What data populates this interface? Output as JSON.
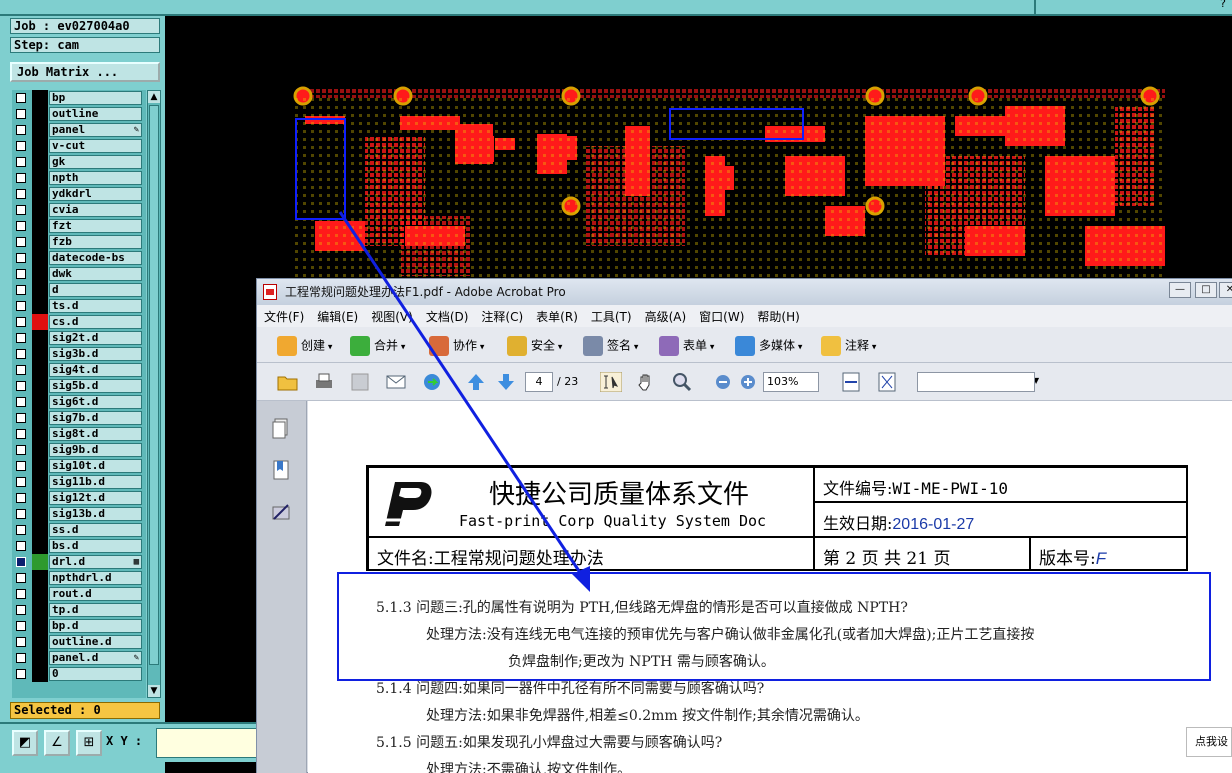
{
  "topbar": {
    "right_char": "?"
  },
  "cam": {
    "job_label": "Job : ev027004a0",
    "step_label": "Step: cam",
    "job_matrix_button": "Job Matrix ...",
    "selected_label": "Selected : 0",
    "xy_label": "X Y :",
    "layers": [
      {
        "name": "bp",
        "color": "#000000"
      },
      {
        "name": "outline",
        "color": "#000000"
      },
      {
        "name": "panel",
        "color": "#000000",
        "mark": "✎"
      },
      {
        "name": "v-cut",
        "color": "#000000"
      },
      {
        "name": "gk",
        "color": "#000000"
      },
      {
        "name": "npth",
        "color": "#000000"
      },
      {
        "name": "ydkdrl",
        "color": "#000000"
      },
      {
        "name": "cvia",
        "color": "#000000"
      },
      {
        "name": "fzt",
        "color": "#000000"
      },
      {
        "name": "fzb",
        "color": "#000000"
      },
      {
        "name": "datecode-bs",
        "color": "#000000"
      },
      {
        "name": "dwk",
        "color": "#000000"
      },
      {
        "name": "d",
        "color": "#000000"
      },
      {
        "name": "ts.d",
        "color": "#000000"
      },
      {
        "name": "cs.d",
        "color": "#e01010"
      },
      {
        "name": "sig2t.d",
        "color": "#000000"
      },
      {
        "name": "sig3b.d",
        "color": "#000000"
      },
      {
        "name": "sig4t.d",
        "color": "#000000"
      },
      {
        "name": "sig5b.d",
        "color": "#000000"
      },
      {
        "name": "sig6t.d",
        "color": "#000000"
      },
      {
        "name": "sig7b.d",
        "color": "#000000"
      },
      {
        "name": "sig8t.d",
        "color": "#000000"
      },
      {
        "name": "sig9b.d",
        "color": "#000000"
      },
      {
        "name": "sig10t.d",
        "color": "#000000"
      },
      {
        "name": "sig11b.d",
        "color": "#000000"
      },
      {
        "name": "sig12t.d",
        "color": "#000000"
      },
      {
        "name": "sig13b.d",
        "color": "#000000"
      },
      {
        "name": "ss.d",
        "color": "#000000"
      },
      {
        "name": "bs.d",
        "color": "#000000"
      },
      {
        "name": "drl.d",
        "color": "#2e9a2e",
        "mark": "▦",
        "active": true
      },
      {
        "name": "npthdrl.d",
        "color": "#000000"
      },
      {
        "name": "rout.d",
        "color": "#000000"
      },
      {
        "name": "tp.d",
        "color": "#000000"
      },
      {
        "name": "bp.d",
        "color": "#000000"
      },
      {
        "name": "outline.d",
        "color": "#000000"
      },
      {
        "name": "panel.d",
        "color": "#000000",
        "mark": "✎"
      },
      {
        "name": "0",
        "color": "#000000"
      }
    ]
  },
  "acrobat": {
    "title": "工程常规问题处理办法F1.pdf - Adobe Acrobat Pro",
    "menu": [
      "文件(F)",
      "编辑(E)",
      "视图(V)",
      "文档(D)",
      "注释(C)",
      "表单(R)",
      "工具(T)",
      "高级(A)",
      "窗口(W)",
      "帮助(H)"
    ],
    "toolbar": [
      {
        "label": "创建",
        "icon": "create-icon"
      },
      {
        "label": "合并",
        "icon": "combine-icon"
      },
      {
        "label": "协作",
        "icon": "collaborate-icon"
      },
      {
        "label": "安全",
        "icon": "lock-icon"
      },
      {
        "label": "签名",
        "icon": "pen-icon"
      },
      {
        "label": "表单",
        "icon": "form-icon"
      },
      {
        "label": "多媒体",
        "icon": "multimedia-icon"
      },
      {
        "label": "注释",
        "icon": "comment-icon"
      }
    ],
    "page_current": "4",
    "page_total": "/ 23",
    "zoom": "103%"
  },
  "doc": {
    "company_cn": "快捷公司质量体系文件",
    "company_en": "Fast-print Corp Quality System Doc",
    "doc_no_label": "文件编号:",
    "doc_no": "WI-ME-PWI-10",
    "date_label": "生效日期:",
    "date": "2016-01-27",
    "file_name": "文件名:工程常规问题处理办法",
    "page_info": "第 2 页 共 21 页",
    "version_label": "版本号:",
    "version": "F",
    "lines": [
      "5.1.3  问题三:孔的属性有说明为 PTH,但线路无焊盘的情形是否可以直接做成 NPTH?",
      "处理方法:没有连线无电气连接的预审优先与客户确认做非金属化孔(或者加大焊盘);正片工艺直接按",
      "负焊盘制作;更改为 NPTH 需与顾客确认。",
      "5.1.4  问题四:如果同一器件中孔径有所不同需要与顾客确认吗?",
      "处理方法:如果非免焊器件,相差≤0.2mm 按文件制作;其余情况需确认。",
      "5.1.5  问题五:如果发现孔小焊盘过大需要与顾客确认吗?",
      "处理方法:不需确认,按文件制作。"
    ]
  },
  "popup": "点我设"
}
